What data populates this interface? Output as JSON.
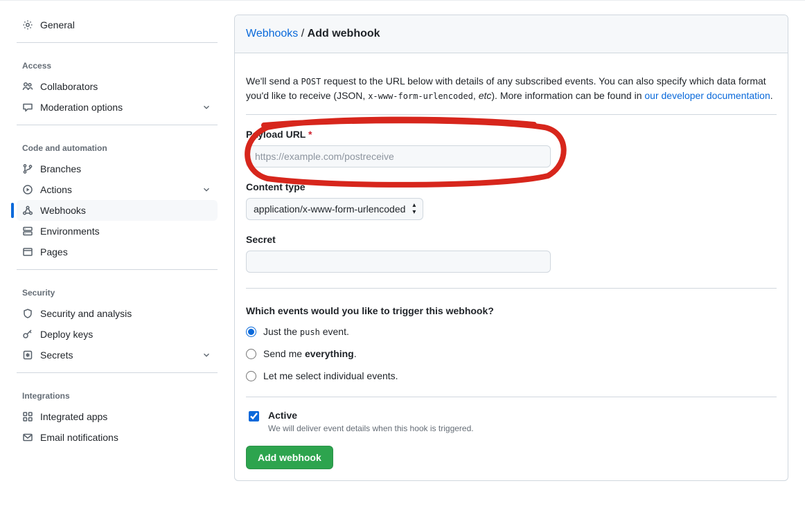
{
  "sidebar": {
    "general": "General",
    "groups": [
      {
        "title": "Access",
        "items": [
          {
            "id": "collaborators",
            "label": "Collaborators"
          },
          {
            "id": "moderation",
            "label": "Moderation options",
            "expandable": true
          }
        ]
      },
      {
        "title": "Code and automation",
        "items": [
          {
            "id": "branches",
            "label": "Branches"
          },
          {
            "id": "actions",
            "label": "Actions",
            "expandable": true
          },
          {
            "id": "webhooks",
            "label": "Webhooks",
            "active": true
          },
          {
            "id": "environments",
            "label": "Environments"
          },
          {
            "id": "pages",
            "label": "Pages"
          }
        ]
      },
      {
        "title": "Security",
        "items": [
          {
            "id": "security-analysis",
            "label": "Security and analysis"
          },
          {
            "id": "deploy-keys",
            "label": "Deploy keys"
          },
          {
            "id": "secrets",
            "label": "Secrets",
            "expandable": true
          }
        ]
      },
      {
        "title": "Integrations",
        "items": [
          {
            "id": "integrated-apps",
            "label": "Integrated apps"
          },
          {
            "id": "email-notifications",
            "label": "Email notifications"
          }
        ]
      }
    ]
  },
  "main": {
    "breadcrumb_parent": "Webhooks",
    "breadcrumb_sep": " / ",
    "breadcrumb_current": "Add webhook",
    "intro_1": "We'll send a ",
    "intro_code1": "POST",
    "intro_2": " request to the URL below with details of any subscribed events. You can also specify which data format you'd like to receive (JSON, ",
    "intro_code2": "x-www-form-urlencoded",
    "intro_3": ", ",
    "intro_em": "etc",
    "intro_4": "). More information can be found in ",
    "intro_link": "our developer documentation",
    "intro_5": ".",
    "payload_label": "Payload URL",
    "payload_required": "*",
    "payload_placeholder": "https://example.com/postreceive",
    "payload_value": "",
    "content_type_label": "Content type",
    "content_type_value": "application/x-www-form-urlencoded",
    "secret_label": "Secret",
    "secret_value": "",
    "events_title": "Which events would you like to trigger this webhook?",
    "radio1_a": "Just the ",
    "radio1_code": "push",
    "radio1_b": " event.",
    "radio2_a": "Send me ",
    "radio2_strong": "everything",
    "radio2_b": ".",
    "radio3": "Let me select individual events.",
    "active_label": "Active",
    "active_sub": "We will deliver event details when this hook is triggered.",
    "submit": "Add webhook"
  }
}
